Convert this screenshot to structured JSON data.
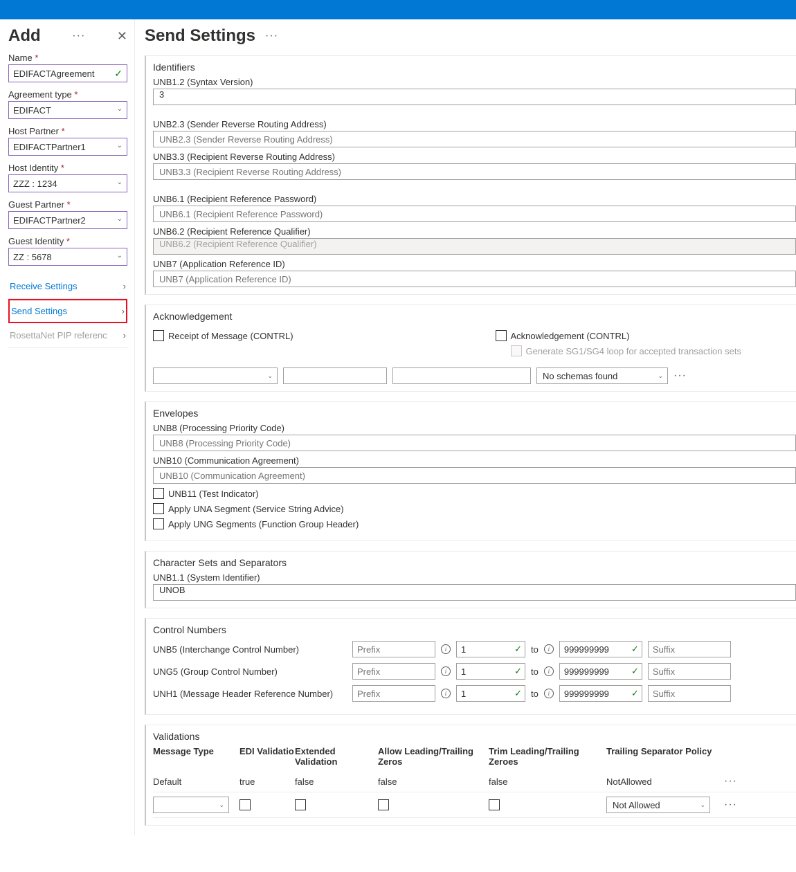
{
  "sidebar": {
    "title": "Add",
    "nameLabel": "Name",
    "nameValue": "EDIFACTAgreement",
    "agreeLabel": "Agreement type",
    "agreeValue": "EDIFACT",
    "hostPartnerLabel": "Host Partner",
    "hostPartnerValue": "EDIFACTPartner1",
    "hostIdLabel": "Host Identity",
    "hostIdValue": "ZZZ : 1234",
    "guestPartnerLabel": "Guest Partner",
    "guestPartnerValue": "EDIFACTPartner2",
    "guestIdLabel": "Guest Identity",
    "guestIdValue": "ZZ : 5678",
    "nav1": "Receive Settings",
    "nav2": "Send Settings",
    "nav3": "RosettaNet PIP referenc"
  },
  "page": {
    "title": "Send Settings"
  },
  "identifiers": {
    "title": "Identifiers",
    "unb12Label": "UNB1.2 (Syntax Version)",
    "unb12Value": "3",
    "unb23Label": "UNB2.3 (Sender Reverse Routing Address)",
    "unb23Ph": "UNB2.3 (Sender Reverse Routing Address)",
    "unb33Label": "UNB3.3 (Recipient Reverse Routing Address)",
    "unb33Ph": "UNB3.3 (Recipient Reverse Routing Address)",
    "unb61Label": "UNB6.1 (Recipient Reference Password)",
    "unb61Ph": "UNB6.1 (Recipient Reference Password)",
    "unb62Label": "UNB6.2 (Recipient Reference Qualifier)",
    "unb62Ph": "UNB6.2 (Recipient Reference Qualifier)",
    "unb7Label": "UNB7 (Application Reference ID)",
    "unb7Ph": "UNB7 (Application Reference ID)"
  },
  "ack": {
    "title": "Acknowledgement",
    "receipt": "Receipt of Message (CONTRL)",
    "ackCtrl": "Acknowledgement (CONTRL)",
    "genLoop": "Generate SG1/SG4 loop for accepted transaction sets",
    "noSchema": "No schemas found"
  },
  "env": {
    "title": "Envelopes",
    "unb8Label": "UNB8 (Processing Priority Code)",
    "unb8Ph": "UNB8 (Processing Priority Code)",
    "unb10Label": "UNB10 (Communication Agreement)",
    "unb10Ph": "UNB10 (Communication Agreement)",
    "unb11": "UNB11 (Test Indicator)",
    "una": "Apply UNA Segment (Service String Advice)",
    "ung": "Apply UNG Segments (Function Group Header)"
  },
  "charsec": {
    "title": "Character Sets and Separators",
    "unb11Label": "UNB1.1 (System Identifier)",
    "unb11Value": "UNOB"
  },
  "ctrl": {
    "title": "Control Numbers",
    "unb5": "UNB5 (Interchange Control Number)",
    "ung5": "UNG5 (Group Control Number)",
    "unh1": "UNH1 (Message Header Reference Number)",
    "prefix": "Prefix",
    "from": "1",
    "to": "to",
    "max": "999999999",
    "suffix": "Suffix"
  },
  "val": {
    "title": "Validations",
    "h1": "Message Type",
    "h2": "EDI Validatio",
    "h3": "Extended Validation",
    "h4": "Allow Leading/Trailing Zeros",
    "h5": "Trim Leading/Trailing Zeroes",
    "h6": "Trailing Separator Policy",
    "default": "Default",
    "true": "true",
    "false": "false",
    "notAllowed": "NotAllowed",
    "notAllowedDd": "Not Allowed"
  }
}
